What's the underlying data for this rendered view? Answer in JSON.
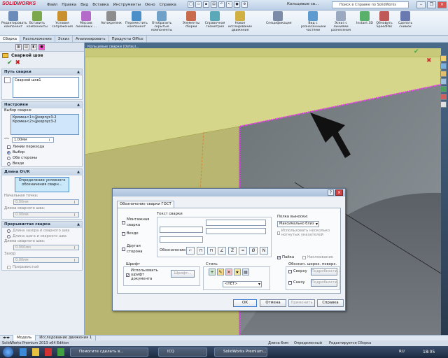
{
  "app": {
    "logo": "SOLIDWORKS",
    "doc_title": "Кольцевые св...",
    "help_search_placeholder": "Поиск в Справке по SolidWorks"
  },
  "menu": [
    "Файл",
    "Правка",
    "Вид",
    "Вставка",
    "Инструменты",
    "Окно",
    "Справка"
  ],
  "ribbon": [
    {
      "label": "Редактировать компонент",
      "color": "#6b8bb8"
    },
    {
      "label": "Вставить компоненты",
      "color": "#7aa84a"
    },
    {
      "label": "Условия сопряжения",
      "color": "#c8912e"
    },
    {
      "label": "Массив линейных ...",
      "color": "#b46ac8"
    },
    {
      "label": "Автокрепеж",
      "color": "#8d8d8d"
    },
    {
      "label": "Переместить компонент",
      "color": "#4b8fc8"
    },
    {
      "label": "Отобразить скрытые компоненты",
      "color": "#6fa0c8"
    },
    {
      "label": "Элементы сборки",
      "color": "#c86b4b"
    },
    {
      "label": "Справочная геометрия",
      "color": "#5aa8b8"
    },
    {
      "label": "Новое исследование движения",
      "color": "#d0b040"
    },
    {
      "label": "Спецификация",
      "color": "#7c8ca8"
    },
    {
      "label": "Вид с разнесенными частями",
      "color": "#5c9ad0"
    },
    {
      "label": "Эскиз с линиями разнесения",
      "color": "#9aa8c0"
    },
    {
      "label": "Instant 3D",
      "color": "#58b06a"
    },
    {
      "label": "Обновить SpeedPak",
      "color": "#c05858"
    },
    {
      "label": "Сделать снимок",
      "color": "#6a7ab0"
    }
  ],
  "cm_tabs": [
    "Сборка",
    "Расположение",
    "Эскиз",
    "Анализировать",
    "Продукты Office"
  ],
  "pm": {
    "title": "Сварной шов",
    "path_group": "Путь сварки",
    "path_item": "Сварной шов1",
    "settings_group": "Настройки",
    "selection_label": "Выбор сварки:",
    "selection_items": [
      "Кромка<1>@корпус3-2",
      "Кромка<2>@корпус3-2"
    ],
    "size_value": "1.00мм",
    "tangent_label": "Линии перехода",
    "radio_selection": "Выбор",
    "radio_both": "Обе стороны",
    "radio_all": "Везде",
    "length_group": "Длина От/К",
    "define_button": "Определение условного обозначения сварн...",
    "start_point_label": "Начальная точка:",
    "start_value": "0.00мм",
    "length_label": "Длина сварного шва:",
    "length_value": "0.00мм",
    "intermittent_group": "Прерывистая сварка",
    "gap_label": "Длина зазора и сварного шва",
    "pitch_label": "Длина шага и сварного шва",
    "weld_length_label": "Длина сварного шва:",
    "weld_length_value": "0.000мм",
    "gap2_label": "Зазор:",
    "gap2_value": "0.00мм",
    "staggered_label": "Прерывистый"
  },
  "viewport": {
    "tree_label": "Кольцевые сварки (Defaul..."
  },
  "dialog": {
    "tab": "Обозначение сварки ГОСТ",
    "mount_weld": "Монтажная сварка",
    "all_around": "Везде",
    "other_side": "Другая сторона",
    "weld_text_label": "Текст сварки",
    "designation_label": "Обозначение:",
    "symbols": [
      "⌐",
      "⊓",
      "⊓",
      "∠",
      "Z",
      "═",
      "Ø",
      "N"
    ],
    "leader_label": "Полка выноски:",
    "leader_value": "Максимально близ",
    "multiple_leaders": "Использовать несколько ногнутых указателей",
    "font_group": "Шрифт",
    "use_doc_font": "Использовать шрифт документа",
    "font_button": "Шрифт...",
    "style_group": "Стиль",
    "style_value": "<НЕТ>",
    "solder": "Пайка",
    "inclination": "Наклеивание",
    "surface_roughness": "Обознач. шерох. поверх.",
    "top_check": "Сверху",
    "bottom_check": "Снизу",
    "details_button": "Подробности...",
    "ok": "ОК",
    "cancel": "Отмена",
    "apply": "Применить",
    "help": "Справка"
  },
  "status": {
    "edition": "SolidWorks Premium 2013 x64 Edition",
    "model_tab": "Модель",
    "motion_tab": "Исследование движения 1",
    "length_status": "Длина 6мм",
    "defined": "Определенный",
    "editing": "Редактируется Сборка"
  },
  "taskbar": {
    "items": [
      "Помогите сделать в...",
      "ICQ",
      "SolidWorks Premium..."
    ],
    "language": "RU",
    "time": "18:05"
  }
}
